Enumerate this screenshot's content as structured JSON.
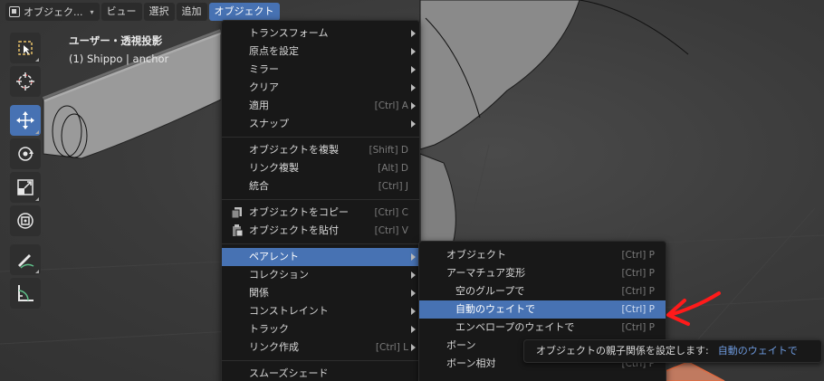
{
  "header": {
    "mode_label": "オブジェク...",
    "menus": [
      "ビュー",
      "選択",
      "追加",
      "オブジェクト"
    ]
  },
  "viewport": {
    "view_name": "ユーザー・透視投影",
    "object_info": "(1) Shippo | anchor"
  },
  "toolbar": {
    "tools": [
      "select-box-icon",
      "cursor-icon",
      "move-icon",
      "rotate-icon",
      "scale-icon",
      "transform-icon",
      "annotate-icon",
      "measure-icon"
    ],
    "active_index": 2
  },
  "object_menu": {
    "items": [
      {
        "label": "トランスフォーム",
        "shortcut": "",
        "submenu": true
      },
      {
        "label": "原点を設定",
        "shortcut": "",
        "submenu": true
      },
      {
        "label": "ミラー",
        "shortcut": "",
        "submenu": true
      },
      {
        "label": "クリア",
        "shortcut": "",
        "submenu": true
      },
      {
        "label": "適用",
        "shortcut": "[Ctrl] A",
        "submenu": true
      },
      {
        "label": "スナップ",
        "shortcut": "",
        "submenu": true
      },
      {
        "label": "オブジェクトを複製",
        "shortcut": "[Shift] D",
        "submenu": false
      },
      {
        "label": "リンク複製",
        "shortcut": "[Alt] D",
        "submenu": false
      },
      {
        "label": "統合",
        "shortcut": "[Ctrl] J",
        "submenu": false
      },
      {
        "label": "オブジェクトをコピー",
        "shortcut": "[Ctrl] C",
        "submenu": false
      },
      {
        "label": "オブジェクトを貼付",
        "shortcut": "[Ctrl] V",
        "submenu": false
      },
      {
        "label": "ペアレント",
        "shortcut": "",
        "submenu": true
      },
      {
        "label": "コレクション",
        "shortcut": "",
        "submenu": true
      },
      {
        "label": "関係",
        "shortcut": "",
        "submenu": true
      },
      {
        "label": "コンストレイント",
        "shortcut": "",
        "submenu": true
      },
      {
        "label": "トラック",
        "shortcut": "",
        "submenu": true
      },
      {
        "label": "リンク作成",
        "shortcut": "[Ctrl] L",
        "submenu": true
      },
      {
        "label": "スムーズシェード",
        "shortcut": "",
        "submenu": false
      }
    ]
  },
  "parent_menu": {
    "items": [
      {
        "label": "オブジェクト",
        "shortcut": "[Ctrl] P"
      },
      {
        "label": "アーマチュア変形",
        "shortcut": "[Ctrl] P"
      },
      {
        "label": "空のグループで",
        "shortcut": "[Ctrl] P"
      },
      {
        "label": "自動のウェイトで",
        "shortcut": "[Ctrl] P"
      },
      {
        "label": "エンベロープのウェイトで",
        "shortcut": "[Ctrl] P"
      },
      {
        "label": "ボーン",
        "shortcut": ""
      },
      {
        "label": "ボーン相対",
        "shortcut": "[Ctrl] P"
      }
    ]
  },
  "tooltip": {
    "text": "オブジェクトの親子関係を設定します:",
    "value": "自動のウェイトで"
  },
  "colors": {
    "accent": "#4772b3",
    "annotation_arrow": "#ff1a1a"
  }
}
